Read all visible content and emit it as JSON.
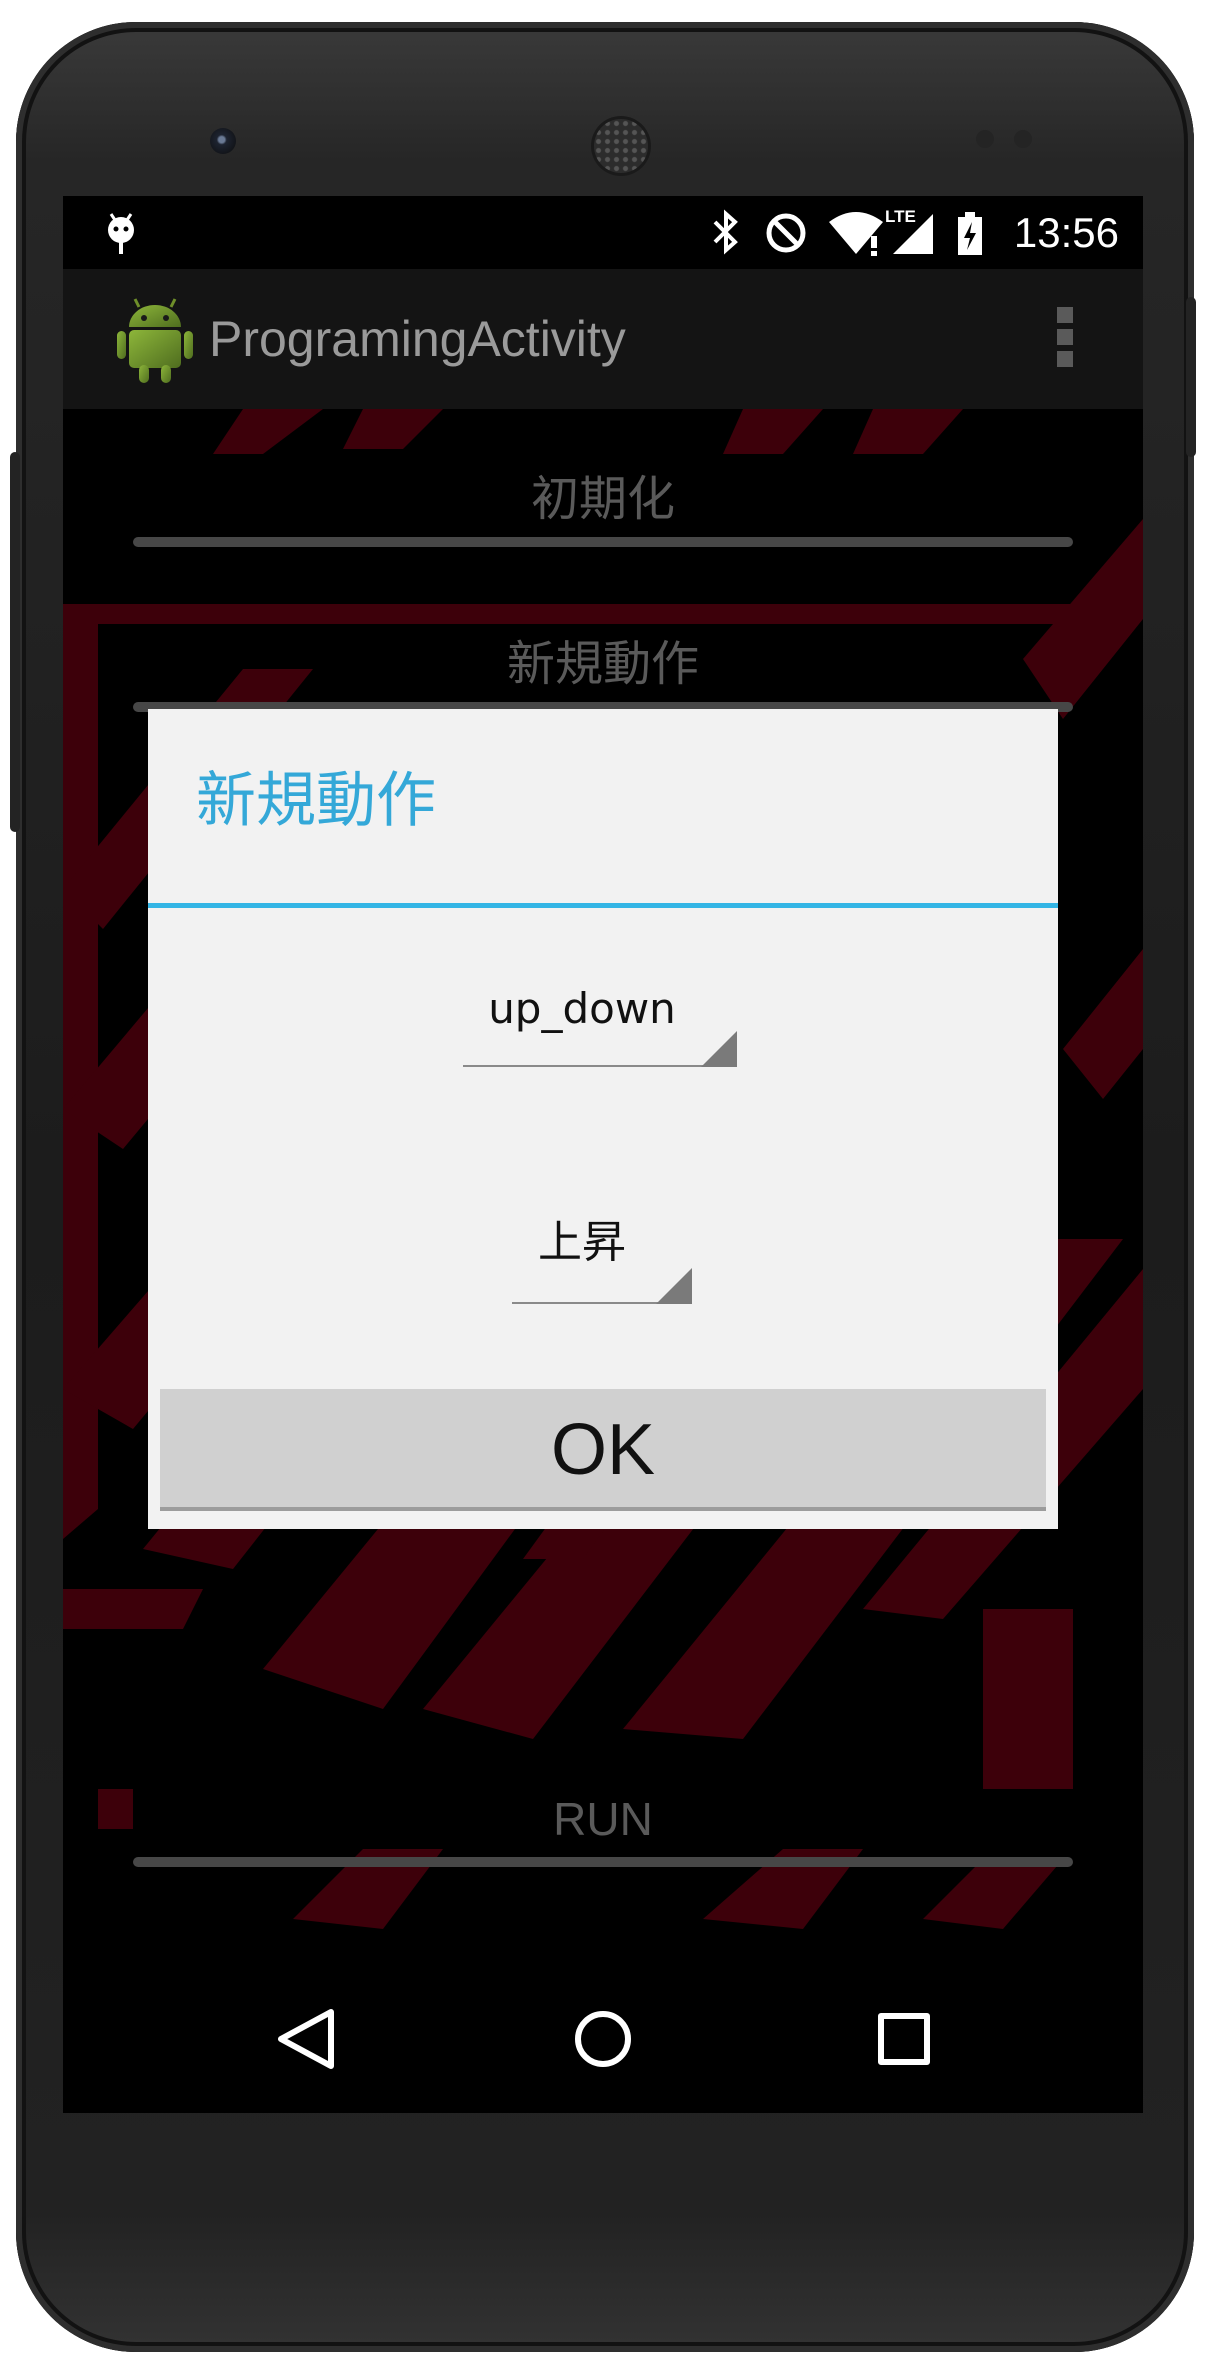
{
  "status_bar": {
    "time": "13:56",
    "lte_label": "LTE",
    "icons": [
      "android-debug-icon",
      "bluetooth-icon",
      "do-not-disturb-icon",
      "wifi-icon",
      "signal-icon",
      "battery-charging-icon"
    ]
  },
  "action_bar": {
    "title": "ProgramingActivity",
    "app_icon": "android-robot-icon",
    "overflow_icon": "overflow-menu-icon"
  },
  "background_buttons": {
    "init_label": "初期化",
    "new_action_label": "新規動作",
    "run_label": "RUN"
  },
  "dialog": {
    "title": "新規動作",
    "spinner_name_value": "up_down",
    "spinner_motion_value": "上昇",
    "ok_label": "OK"
  },
  "colors": {
    "dialog_accent": "#33b5e5",
    "background_stripes": "#5e0010",
    "dialog_background": "#f2f2f2"
  },
  "nav_bar": {
    "icons": [
      "back-icon",
      "home-icon",
      "recents-icon"
    ]
  }
}
